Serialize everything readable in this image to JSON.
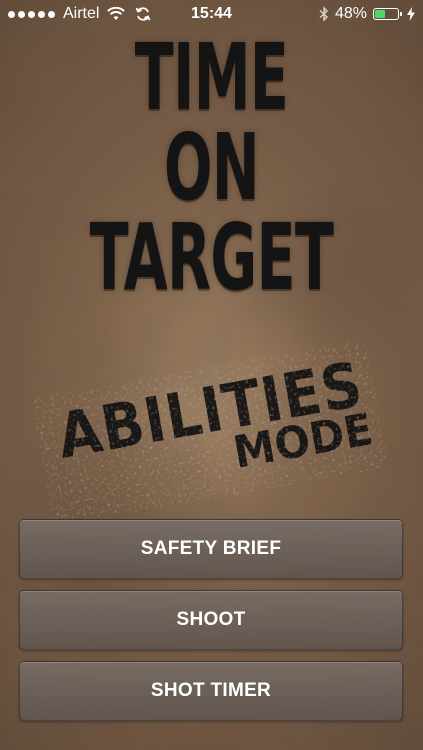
{
  "status_bar": {
    "carrier": "Airtel",
    "time": "15:44",
    "battery_percent_label": "48%",
    "battery_level": 0.48,
    "battery_color": "#4cd964",
    "icons": [
      "signal-dots-icon",
      "wifi-icon",
      "sync-icon",
      "bluetooth-icon",
      "battery-icon",
      "charging-bolt-icon"
    ]
  },
  "title": {
    "line1": "TIME",
    "line2": "ON",
    "line3": "TARGET"
  },
  "stamp": {
    "main": "ABILITIES",
    "sub": "MODE"
  },
  "menu": {
    "buttons": [
      {
        "label": "SAFETY BRIEF"
      },
      {
        "label": "SHOOT"
      },
      {
        "label": "SHOT TIMER"
      }
    ]
  }
}
